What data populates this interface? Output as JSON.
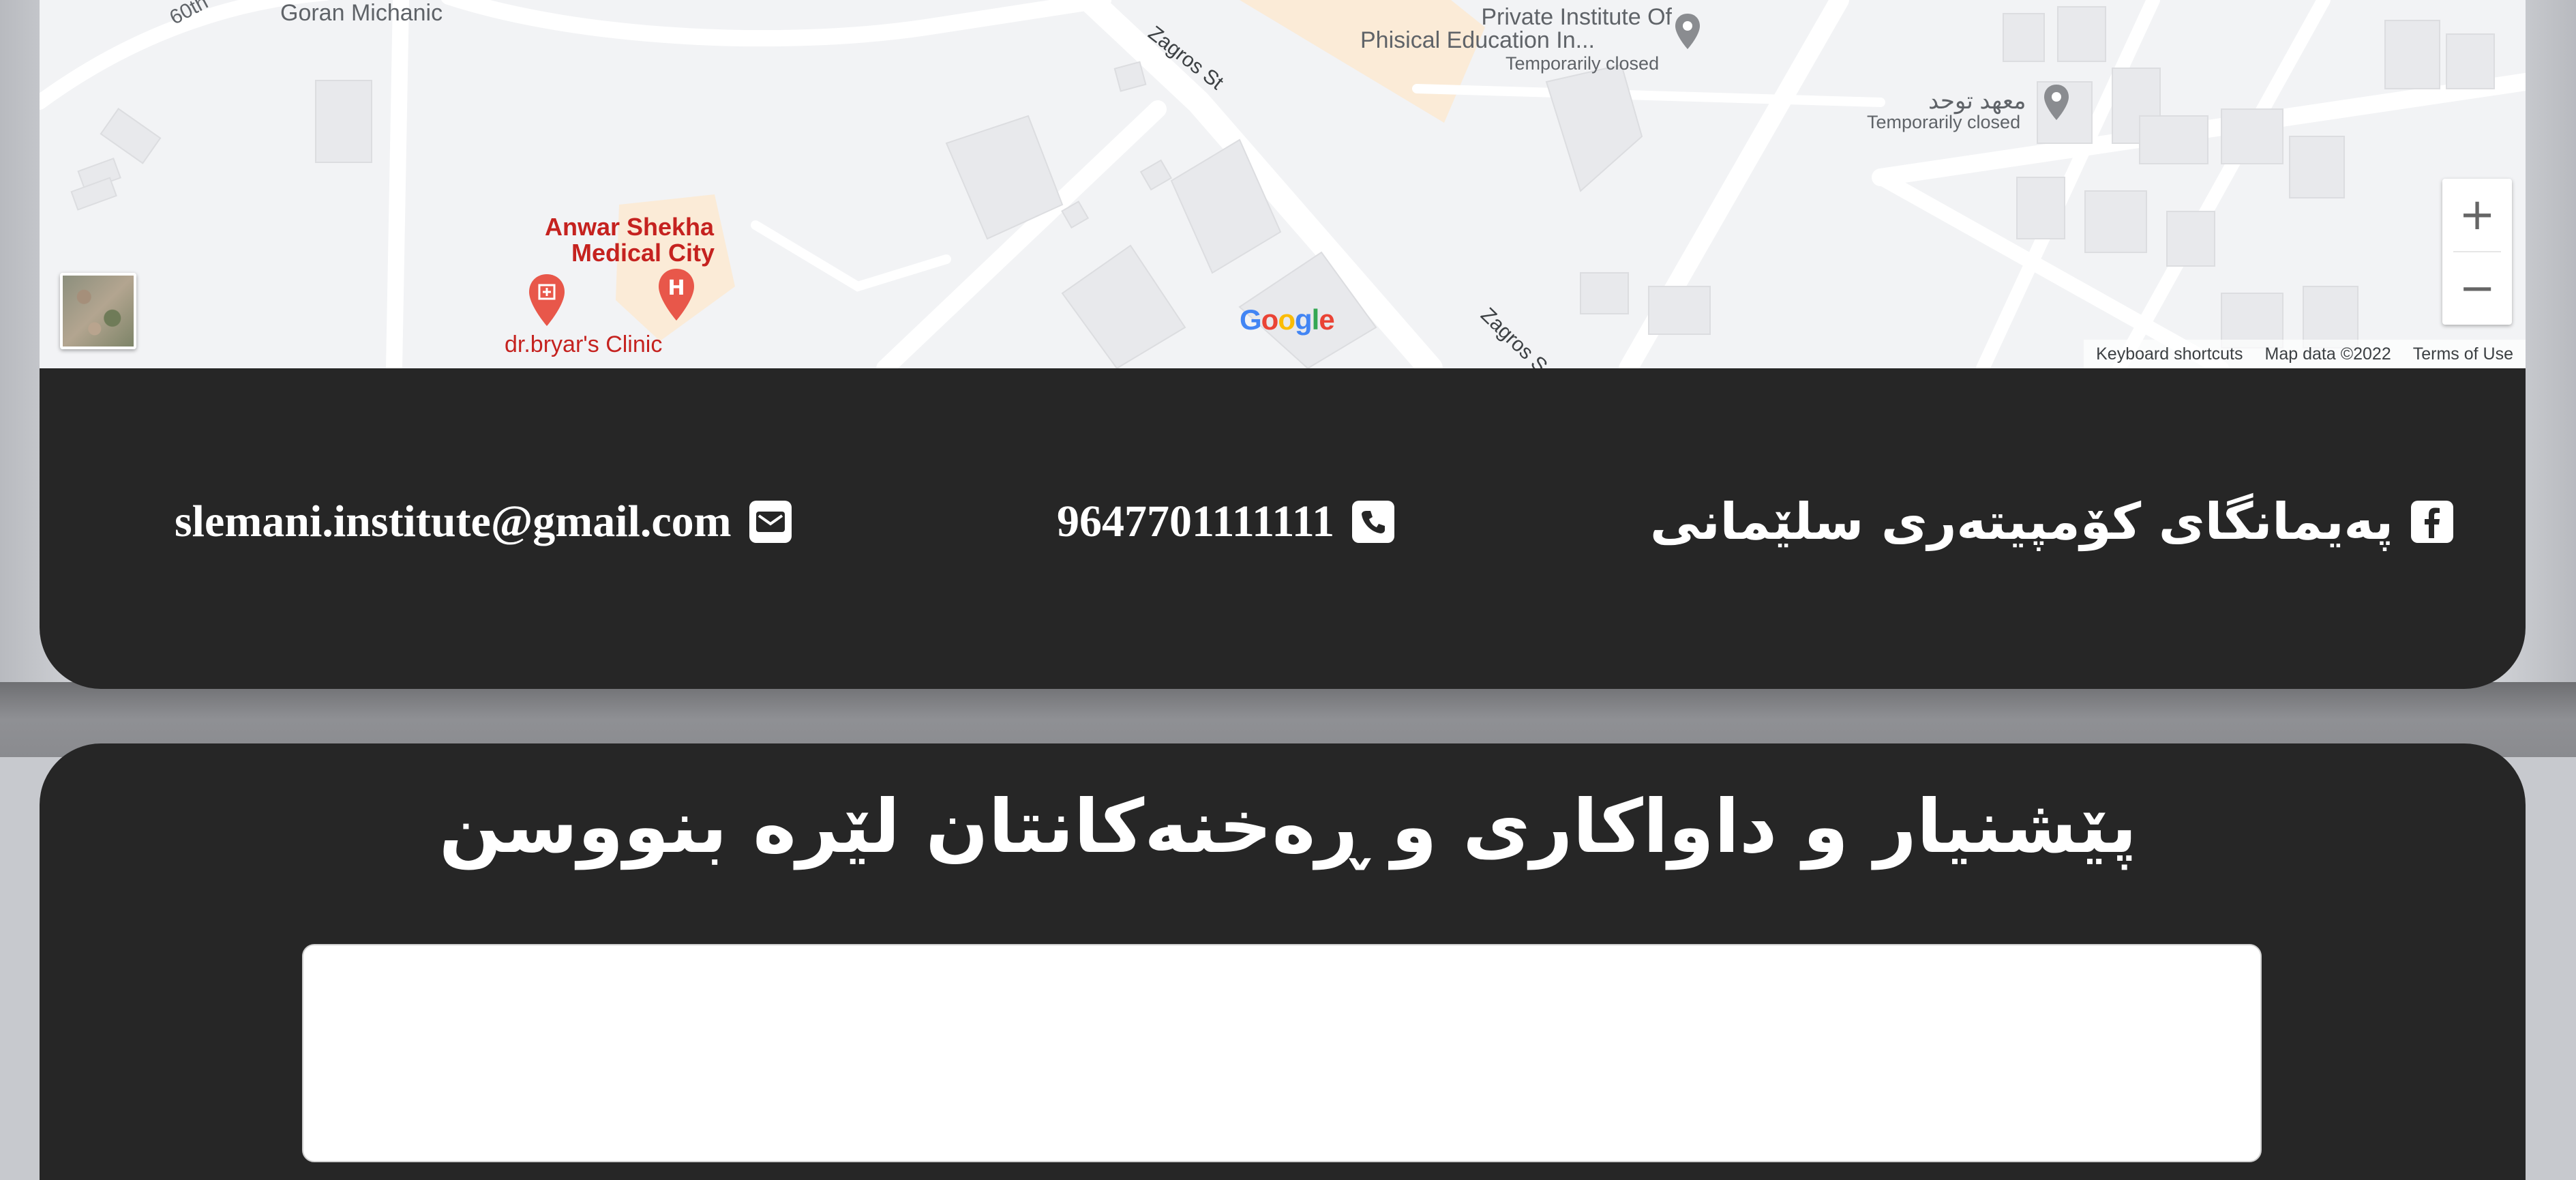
{
  "map": {
    "labels": {
      "goran": "Goran Michanic",
      "street_60": "60th",
      "private_institute_l1": "Private Institute Of",
      "private_institute_l2": "Phisical Education In...",
      "private_institute_status": "Temporarily closed",
      "mahad": "معهد توحد",
      "mahad_status": "Temporarily closed",
      "zagros1": "Zagros St",
      "zagros2": "Zagros S",
      "anwar_l1": "Anwar Shekha",
      "anwar_l2": "Medical City",
      "bryar": "dr.bryar's Clinic"
    },
    "zoom_in": "+",
    "zoom_out": "−",
    "google_logo": [
      "G",
      "o",
      "o",
      "g",
      "l",
      "e"
    ],
    "google_colors": [
      "#4285F4",
      "#EA4335",
      "#FBBC05",
      "#4285F4",
      "#34A853",
      "#EA4335"
    ],
    "attribution": {
      "shortcuts": "Keyboard shortcuts",
      "map_data": "Map data ©2022",
      "terms": "Terms of Use"
    }
  },
  "footer": {
    "email": "slemani.institute@gmail.com",
    "email_icon": "envelope-icon",
    "phone": "9647701111111",
    "phone_icon": "phone-icon",
    "facebook": "پەیمانگای کۆمپیتەری سلێمانی",
    "facebook_icon": "facebook-icon"
  },
  "feedback": {
    "title": "پێشنیار و داواکاری و ڕەخنەکانتان لێرە بنووسن",
    "textarea_value": ""
  },
  "colors": {
    "panel": "#262626",
    "map_bg": "#f2f3f5",
    "medical_red": "#c5221f"
  }
}
